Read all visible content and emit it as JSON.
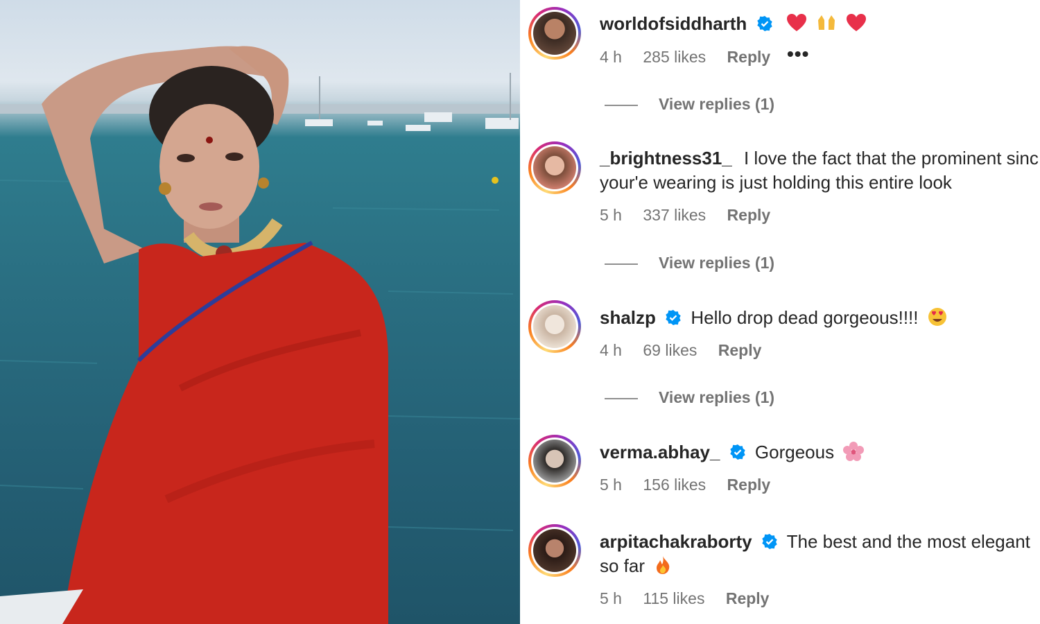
{
  "comments": [
    {
      "username": "worldofsiddharth",
      "verified": true,
      "text": "",
      "emojis": [
        "heart-icon",
        "raised-hands-icon",
        "heart-icon"
      ],
      "time": "4 h",
      "likes": "285 likes",
      "reply": "Reply",
      "more": "•••",
      "view_replies": "View replies (1)"
    },
    {
      "username": "_brightness31_",
      "verified": false,
      "text": "I love the fact that the prominent sinc",
      "text_line2": "your'e wearing is just holding this entire look",
      "time": "5 h",
      "likes": "337 likes",
      "reply": "Reply",
      "view_replies": "View replies (1)"
    },
    {
      "username": "shalzp",
      "verified": true,
      "text": "Hello drop dead gorgeous!!!!",
      "emojis": [
        "heart-eyes-icon"
      ],
      "time": "4 h",
      "likes": "69 likes",
      "reply": "Reply",
      "view_replies": "View replies (1)"
    },
    {
      "username": "verma.abhay_",
      "verified": true,
      "text": "Gorgeous",
      "emojis": [
        "cherry-blossom-icon"
      ],
      "time": "5 h",
      "likes": "156 likes",
      "reply": "Reply"
    },
    {
      "username": "arpitachakraborty",
      "verified": true,
      "text": "The best and the most elegant",
      "text_line2": "so far",
      "emojis": [
        "fire-icon"
      ],
      "time": "5 h",
      "likes": "115 likes",
      "reply": "Reply"
    }
  ],
  "colors": {
    "text": "#262626",
    "meta": "#737373",
    "verified": "#0095f6",
    "saree": "#c8261c"
  }
}
